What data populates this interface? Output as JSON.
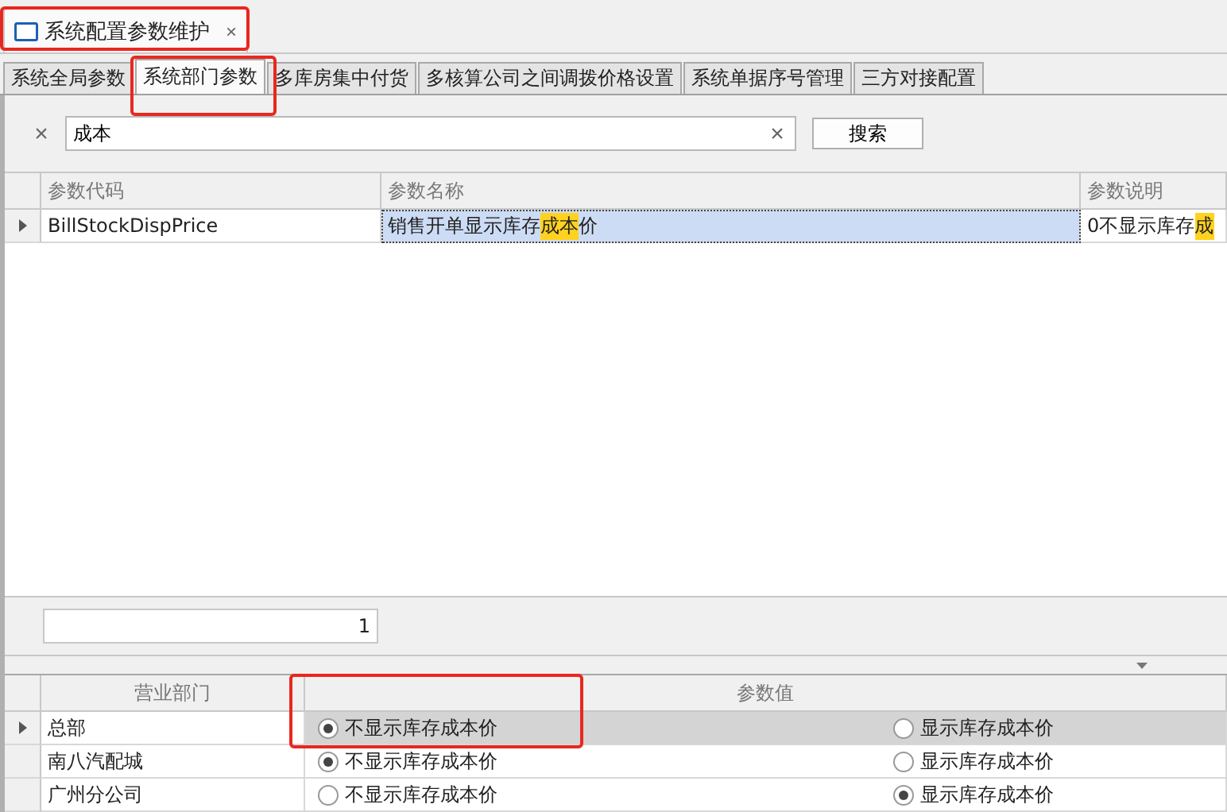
{
  "document_tab": {
    "title": "系统配置参数维护",
    "close": "×"
  },
  "tabs": [
    {
      "label": "系统全局参数",
      "selected": false
    },
    {
      "label": "系统部门参数",
      "selected": true
    },
    {
      "label": "多库房集中付货",
      "selected": false
    },
    {
      "label": "多核算公司之间调拨价格设置",
      "selected": false
    },
    {
      "label": "系统单据序号管理",
      "selected": false
    },
    {
      "label": "三方对接配置",
      "selected": false
    }
  ],
  "search": {
    "clear_filter": "×",
    "value": "成本",
    "clear_value": "×",
    "button": "搜索"
  },
  "params_table": {
    "columns": [
      "参数代码",
      "参数名称",
      "参数说明"
    ],
    "rows": [
      {
        "selected": true,
        "code": "BillStockDispPrice",
        "name": [
          {
            "text": "销售开单显示库存",
            "highlight": false
          },
          {
            "text": "成本",
            "highlight": true
          },
          {
            "text": "价",
            "highlight": false
          }
        ],
        "description": [
          {
            "text": "0不显示库存",
            "highlight": false
          },
          {
            "text": "成",
            "highlight": true
          }
        ]
      }
    ]
  },
  "record_count": "1",
  "dept_table": {
    "columns": [
      "营业部门",
      "参数值"
    ],
    "rows": [
      {
        "selected": true,
        "dept": "总部",
        "options": [
          {
            "label": "不显示库存成本价",
            "selected": true
          },
          {
            "label": "显示库存成本价",
            "selected": false
          }
        ]
      },
      {
        "selected": false,
        "dept": "南八汽配城",
        "options": [
          {
            "label": "不显示库存成本价",
            "selected": true
          },
          {
            "label": "显示库存成本价",
            "selected": false
          }
        ]
      },
      {
        "selected": false,
        "dept": "广州分公司",
        "options": [
          {
            "label": "不显示库存成本价",
            "selected": false
          },
          {
            "label": "显示库存成本价",
            "selected": true
          }
        ]
      }
    ]
  }
}
